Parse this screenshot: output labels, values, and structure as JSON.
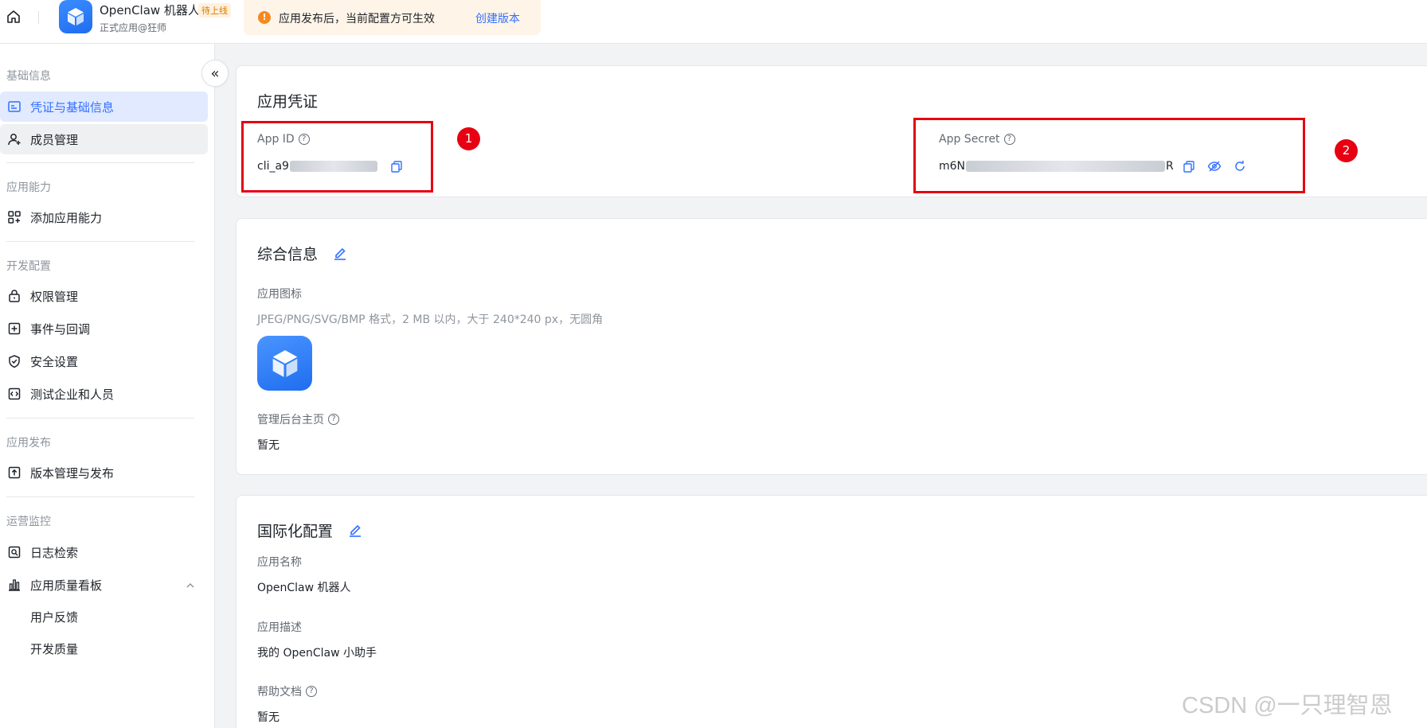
{
  "topbar": {
    "app_name": "OpenClaw 机器人",
    "status_badge": "待上线",
    "subtitle": "正式应用@狂师",
    "notice_icon": "!",
    "notice_text": "应用发布后，当前配置方可生效",
    "notice_link": "创建版本"
  },
  "sidebar": {
    "collapse_icon": "«",
    "sections": {
      "basic": "基础信息",
      "capability": "应用能力",
      "dev": "开发配置",
      "release": "应用发布",
      "ops": "运营监控"
    },
    "items": {
      "credentials": "凭证与基础信息",
      "members": "成员管理",
      "add_capability": "添加应用能力",
      "permissions": "权限管理",
      "events": "事件与回调",
      "security": "安全设置",
      "test_org": "测试企业和人员",
      "versions": "版本管理与发布",
      "logs": "日志检索",
      "quality": "应用质量看板",
      "feedback": "用户反馈",
      "dev_quality": "开发质量"
    }
  },
  "credentials": {
    "title": "应用凭证",
    "app_id_label": "App ID",
    "app_id_value": "cli_a9",
    "app_secret_label": "App Secret",
    "app_secret_prefix": "m6N",
    "app_secret_suffix": "R",
    "marker_1": "1",
    "marker_2": "2"
  },
  "general": {
    "title": "综合信息",
    "icon_label": "应用图标",
    "icon_hint": "JPEG/PNG/SVG/BMP 格式，2 MB 以内，大于 240*240 px，无圆角",
    "admin_label": "管理后台主页",
    "admin_value": "暂无"
  },
  "i18n": {
    "title": "国际化配置",
    "name_label": "应用名称",
    "name_value": "OpenClaw 机器人",
    "desc_label": "应用描述",
    "desc_value": "我的 OpenClaw 小助手",
    "help_label": "帮助文档",
    "help_value": "暂无"
  },
  "watermark": "CSDN @一只理智恩",
  "colors": {
    "accent": "#3370ff",
    "active_bg": "#e1eaff",
    "annotation_red": "#e60012",
    "notice_bg": "#fff4e8"
  }
}
